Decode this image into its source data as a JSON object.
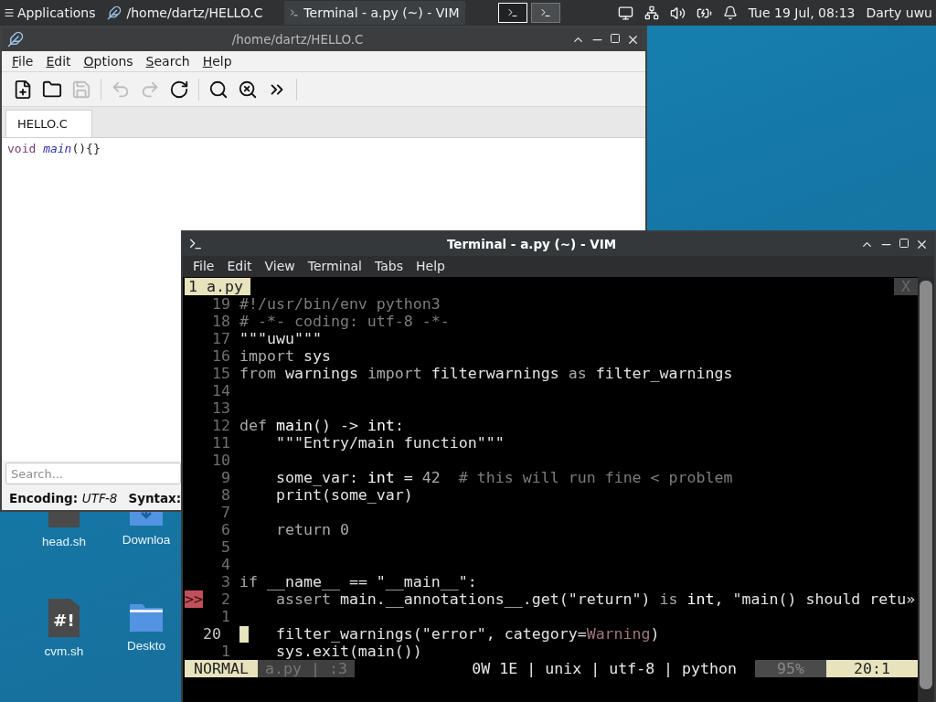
{
  "panel": {
    "apps_label": "Applications",
    "tasks": [
      {
        "title": "/home/dartz/HELLO.C",
        "kind": "editor",
        "selected": false
      },
      {
        "title": "Terminal - a.py (~) - VIM",
        "kind": "terminal",
        "selected": true
      }
    ],
    "workspaces": [
      {
        "selected": true
      },
      {
        "selected": false
      }
    ],
    "clock": "Tue 19 Jul, 08:13",
    "user": "Darty uwu"
  },
  "desktop_icons": [
    {
      "label": "head.sh",
      "kind": "script"
    },
    {
      "label": "Downloa",
      "kind": "downloads"
    },
    {
      "label": "cvm.sh",
      "kind": "script",
      "glyph": "#!"
    },
    {
      "label": "Deskto",
      "kind": "folder"
    }
  ],
  "editor": {
    "title": "/home/dartz/HELLO.C",
    "menu": [
      "File",
      "Edit",
      "Options",
      "Search",
      "Help"
    ],
    "toolbar": [
      {
        "kind": "new",
        "disabled": false
      },
      {
        "kind": "open",
        "disabled": false
      },
      {
        "kind": "save",
        "disabled": true
      },
      {
        "kind": "sep"
      },
      {
        "kind": "undo",
        "disabled": true
      },
      {
        "kind": "redo",
        "disabled": true
      },
      {
        "kind": "reload",
        "disabled": false
      },
      {
        "kind": "sep"
      },
      {
        "kind": "find",
        "disabled": false
      },
      {
        "kind": "replace",
        "disabled": false
      },
      {
        "kind": "more",
        "disabled": false
      },
      {
        "kind": "sep"
      }
    ],
    "tabs": [
      {
        "label": "HELLO.C",
        "selected": true
      }
    ],
    "code": [
      [
        {
          "text": "void",
          "kind": "type"
        },
        {
          "text": " main",
          "kind": "function"
        },
        {
          "text": "(){}",
          "kind": "plain"
        }
      ]
    ],
    "search": {
      "placeholder": "Search..."
    },
    "status": [
      {
        "label": "Encoding:",
        "value": "UTF-8"
      },
      {
        "label": "Syntax:"
      }
    ]
  },
  "terminal": {
    "title": "Terminal - a.py (~) - VIM",
    "menu": [
      "File",
      "Edit",
      "View",
      "Terminal",
      "Tabs",
      "Help"
    ],
    "vim": {
      "tabs": [
        {
          "label": "1 a.py",
          "selected": true
        }
      ],
      "close_label": "X",
      "lines": [
        {
          "number": "19",
          "current": false,
          "tokens": [
            {
              "text": "#!/usr/bin/env python3",
              "kind": "comment"
            }
          ]
        },
        {
          "number": "18",
          "current": false,
          "tokens": [
            {
              "text": "# -*- coding: utf-8 -*-",
              "kind": "comment"
            }
          ]
        },
        {
          "number": "17",
          "current": false,
          "tokens": [
            {
              "text": "\"\"\"uwu\"\"\"",
              "kind": "plain"
            }
          ]
        },
        {
          "number": "16",
          "current": false,
          "tokens": [
            {
              "text": "import",
              "kind": "keyword"
            },
            {
              "text": " sys",
              "kind": "plain"
            }
          ]
        },
        {
          "number": "15",
          "current": false,
          "tokens": [
            {
              "text": "from",
              "kind": "keyword"
            },
            {
              "text": " warnings ",
              "kind": "plain"
            },
            {
              "text": "import",
              "kind": "keyword"
            },
            {
              "text": " filterwarnings ",
              "kind": "plain"
            },
            {
              "text": "as",
              "kind": "keyword"
            },
            {
              "text": " filter_warnings",
              "kind": "plain"
            }
          ]
        },
        {
          "number": "14",
          "current": false
        },
        {
          "number": "13",
          "current": false
        },
        {
          "number": "12",
          "current": false,
          "tokens": [
            {
              "text": "def",
              "kind": "keyword"
            },
            {
              "text": " main",
              "kind": "bright"
            },
            {
              "text": "() -> ",
              "kind": "plain"
            },
            {
              "text": "int",
              "kind": "bright"
            },
            {
              "text": ":",
              "kind": "plain"
            }
          ]
        },
        {
          "number": "11",
          "current": false,
          "tokens": [
            {
              "text": "    \"\"\"Entry/main function\"\"\"",
              "kind": "plain"
            }
          ]
        },
        {
          "number": "10",
          "current": false
        },
        {
          "number": "9",
          "current": false,
          "tokens": [
            {
              "text": "    some_var: ",
              "kind": "plain"
            },
            {
              "text": "int",
              "kind": "bright"
            },
            {
              "text": " = ",
              "kind": "plain"
            },
            {
              "text": "42",
              "kind": "number"
            },
            {
              "text": "  # this will run fine < problem",
              "kind": "comment"
            }
          ]
        },
        {
          "number": "8",
          "current": false,
          "tokens": [
            {
              "text": "    print(some_var)",
              "kind": "plain"
            }
          ]
        },
        {
          "number": "7",
          "current": false
        },
        {
          "number": "6",
          "current": false,
          "tokens": [
            {
              "text": "    return",
              "kind": "keyword"
            },
            {
              "text": " 0",
              "kind": "number"
            }
          ]
        },
        {
          "number": "5",
          "current": false
        },
        {
          "number": "4",
          "current": false
        },
        {
          "number": "3",
          "current": false,
          "tokens": [
            {
              "text": "if",
              "kind": "keyword"
            },
            {
              "text": " __name__ == \"__main__\":",
              "kind": "plain"
            }
          ]
        },
        {
          "number": "2",
          "current": false,
          "sign": ">>",
          "tokens": [
            {
              "text": "    assert",
              "kind": "keyword"
            },
            {
              "text": " main.__annotations__.get(\"return\") ",
              "kind": "plain"
            },
            {
              "text": "is",
              "kind": "keyword"
            },
            {
              "text": " int",
              "kind": "bright"
            },
            {
              "text": ", \"main() should retu»",
              "kind": "plain"
            }
          ]
        },
        {
          "number": "1",
          "current": false
        },
        {
          "number": "20",
          "current": true,
          "tokens": [
            {
              "text": "    filter_warnings(\"error\", category=",
              "kind": "plain"
            },
            {
              "text": "Warning",
              "kind": "exception"
            },
            {
              "text": ")",
              "kind": "plain"
            }
          ]
        },
        {
          "number": "1",
          "current": false,
          "tokens": [
            {
              "text": "    sys.exit(main())",
              "kind": "plain"
            }
          ]
        }
      ],
      "status": {
        "mode": "NORMAL",
        "file": "a.py | :3",
        "info": "0W 1E | unix | utf-8 | python",
        "percent": "95%",
        "position": "20:1"
      }
    }
  }
}
